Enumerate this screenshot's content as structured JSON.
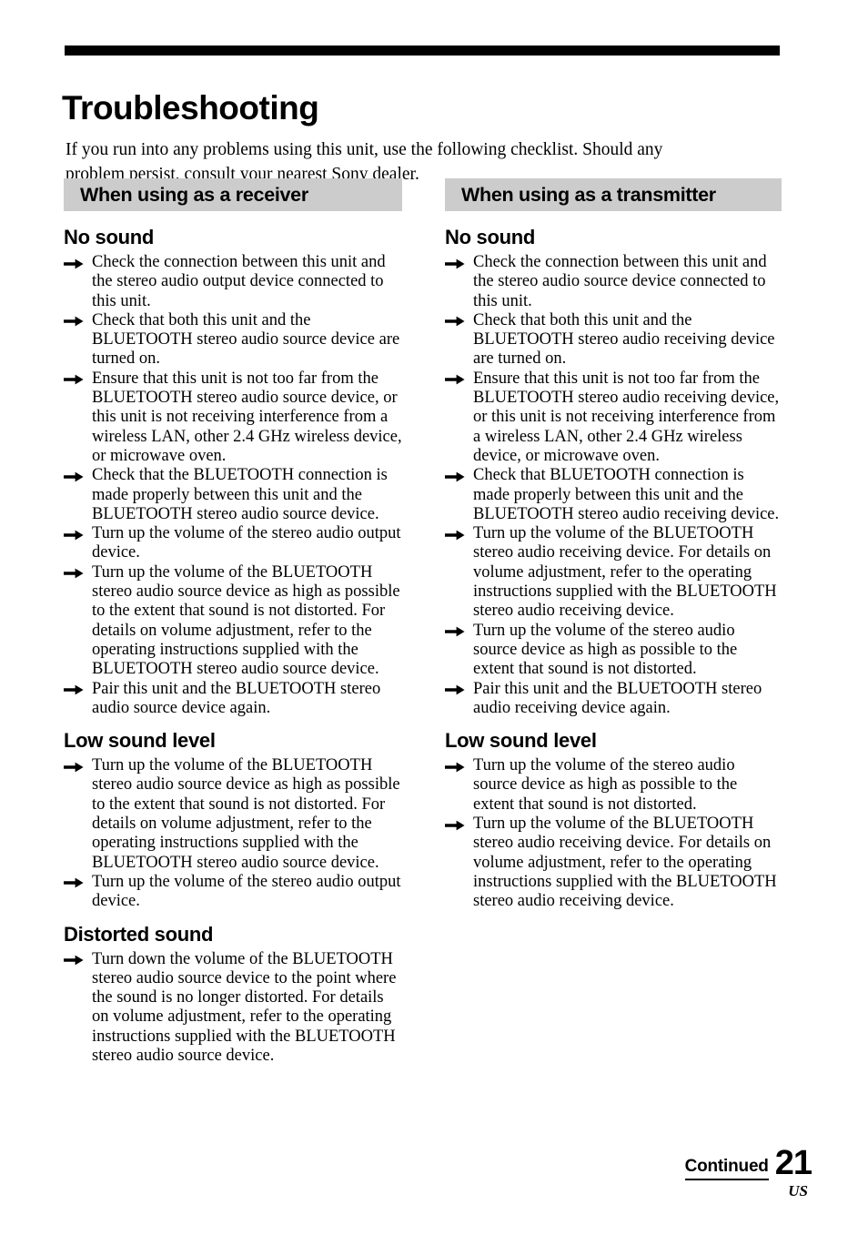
{
  "page": {
    "chapter_title": "Troubleshooting",
    "intro": "If you run into any problems using this unit, use the following checklist. Should any problem persist, consult your nearest Sony dealer.",
    "banner_color": "#cccccc",
    "rule_color": "#000000"
  },
  "columns": {
    "left": {
      "banner_label": "When using as a receiver",
      "sections": [
        {
          "heading": "No sound",
          "items": [
            "Check the connection between this unit and the stereo audio output device connected to this unit.",
            "Check that both this unit and the BLUETOOTH stereo audio source device are turned on.",
            "Ensure that this unit is not too far from the BLUETOOTH stereo audio source device, or this unit is not receiving interference from a wireless LAN, other 2.4 GHz wireless device, or microwave oven.",
            "Check that the BLUETOOTH connection is made properly between this unit and the BLUETOOTH stereo audio source device.",
            "Turn up the volume of the stereo audio output device.",
            "Turn up the volume of the BLUETOOTH stereo audio source device as high as possible to the extent that sound is not distorted. For details on volume adjustment, refer to the operating instructions supplied with the BLUETOOTH stereo audio source device.",
            "Pair this unit and the BLUETOOTH stereo audio source device again."
          ]
        },
        {
          "heading": "Low sound level",
          "items": [
            "Turn up the volume of the BLUETOOTH stereo audio source device as high as possible to the extent that sound is not distorted. For details on volume adjustment, refer to the operating instructions supplied with the BLUETOOTH stereo audio source device.",
            "Turn up the volume of the stereo audio output device."
          ]
        },
        {
          "heading": "Distorted sound",
          "items": [
            "Turn down the volume of the BLUETOOTH stereo audio source device to the point where the sound is no longer distorted. For details on volume adjustment, refer to the operating instructions supplied with the BLUETOOTH stereo audio source device."
          ]
        }
      ]
    },
    "right": {
      "banner_label": "When using as a transmitter",
      "sections": [
        {
          "heading": "No sound",
          "items": [
            "Check the connection between this unit and the stereo audio source device connected to this unit.",
            "Check that both this unit and the BLUETOOTH stereo audio receiving device are turned on.",
            "Ensure that this unit is not too far from the BLUETOOTH stereo audio receiving device, or this unit is not receiving interference from a wireless LAN, other 2.4 GHz wireless device, or microwave oven.",
            "Check that BLUETOOTH connection is made properly between this unit and the BLUETOOTH stereo audio receiving device.",
            "Turn up the volume of the BLUETOOTH stereo audio receiving device. For details on volume adjustment, refer to the operating instructions supplied with the BLUETOOTH stereo audio receiving device.",
            "Turn up the volume of the stereo audio source device as high as possible to the extent that sound is not distorted.",
            "Pair this unit and the BLUETOOTH stereo audio receiving device again."
          ]
        },
        {
          "heading": "Low sound level",
          "items": [
            "Turn up the volume of the stereo audio source device as high as possible to the extent that sound is not distorted.",
            "Turn up the volume of the BLUETOOTH stereo audio receiving device. For details on volume adjustment, refer to the operating instructions supplied with the BLUETOOTH stereo audio receiving device."
          ]
        }
      ]
    }
  },
  "footer": {
    "continued_label": "Continued",
    "page_number": "21",
    "region_code": "US"
  },
  "icons": {
    "bullet": "right-arrow-icon"
  }
}
